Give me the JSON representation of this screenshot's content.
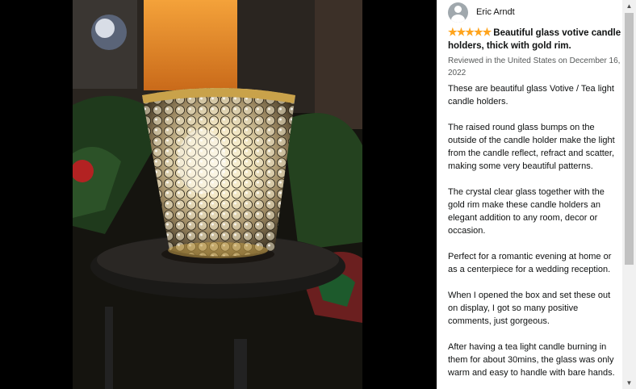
{
  "photo": {
    "icon": "review-photo"
  },
  "review": {
    "reviewer_name": "Eric Arndt",
    "rating": 5,
    "rating_stars": "★★★★★",
    "title": "Beautiful glass votive candle holders, thick with gold rim.",
    "meta": "Reviewed in the United States on December 16, 2022",
    "paragraphs": [
      "These are beautiful glass Votive / Tea light candle holders.",
      "The raised round glass bumps on the outside of the candle holder make the light from the candle reflect, refract and scatter, making some very beautiful patterns.",
      "The crystal clear glass together with the gold rim make these candle holders an elegant addition to any room, decor or occasion.",
      "Perfect for a romantic evening at home or as a centerpiece for a wedding reception.",
      "When I opened the box and set these out on display, I got so many positive comments, just gorgeous.",
      "After having a tea light candle burning in them for about 30mins, the glass was only warm and easy to handle with bare hands."
    ]
  },
  "colors": {
    "star": "#ffa41c",
    "panel_bg": "#ffffff",
    "scroll_thumb": "#c1c1c1"
  }
}
